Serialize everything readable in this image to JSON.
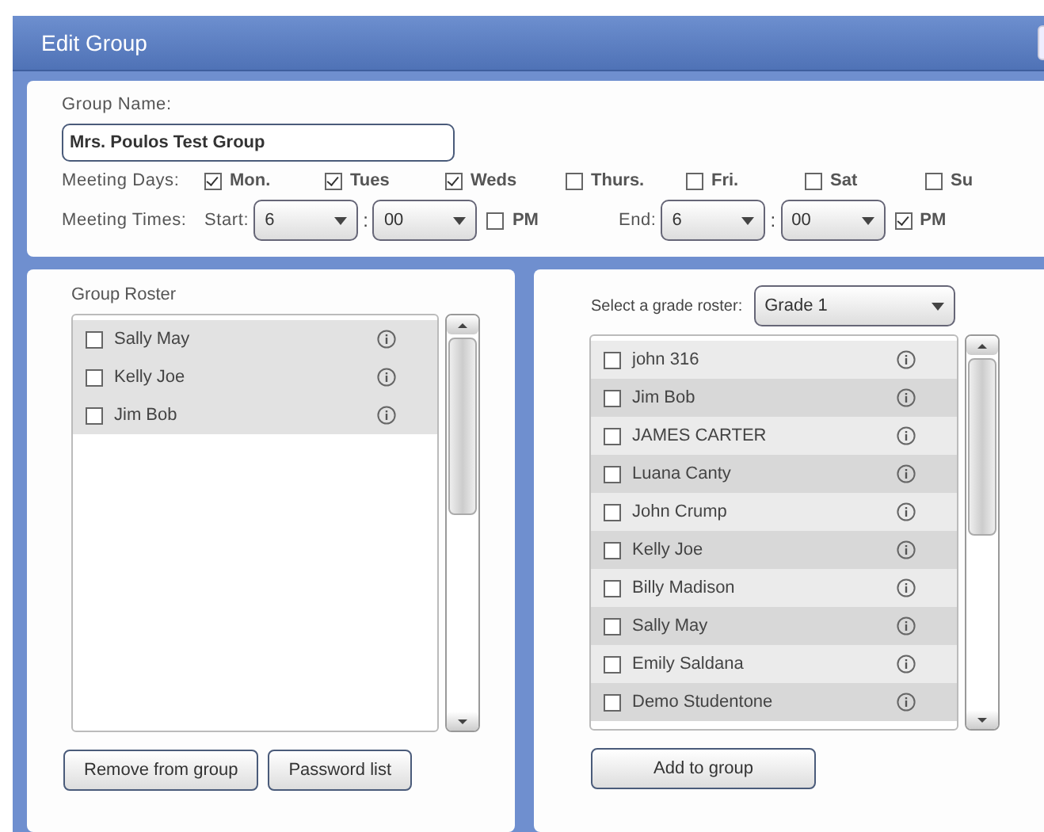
{
  "window": {
    "title": "Edit Group"
  },
  "group_name": {
    "label": "Group Name:",
    "value": "Mrs. Poulos Test Group"
  },
  "meeting_days": {
    "label": "Meeting Days:",
    "days": [
      {
        "label": "Mon.",
        "checked": true
      },
      {
        "label": "Tues",
        "checked": true
      },
      {
        "label": "Weds",
        "checked": true
      },
      {
        "label": "Thurs.",
        "checked": false
      },
      {
        "label": "Fri.",
        "checked": false
      },
      {
        "label": "Sat",
        "checked": false
      },
      {
        "label": "Su",
        "checked": false
      }
    ]
  },
  "meeting_times": {
    "label": "Meeting Times:",
    "start": {
      "label": "Start:",
      "hour": "6",
      "minute": "00",
      "separator": ":",
      "pm_label": "PM",
      "pm": false
    },
    "end": {
      "label": "End:",
      "hour": "6",
      "minute": "00",
      "separator": ":",
      "pm_label": "PM",
      "pm": true
    }
  },
  "group_roster": {
    "title": "Group Roster",
    "students": [
      {
        "name": "Sally May",
        "checked": false
      },
      {
        "name": "Kelly Joe",
        "checked": false
      },
      {
        "name": "Jim Bob",
        "checked": false
      }
    ],
    "buttons": [
      "Remove from group",
      "Password list"
    ]
  },
  "grade_roster": {
    "label": "Select a grade roster:",
    "grade": "Grade 1",
    "students": [
      {
        "name": "john 316",
        "checked": false
      },
      {
        "name": "Jim Bob",
        "checked": false
      },
      {
        "name": "JAMES CARTER",
        "checked": false
      },
      {
        "name": "Luana Canty",
        "checked": false
      },
      {
        "name": "John Crump",
        "checked": false
      },
      {
        "name": "Kelly Joe",
        "checked": false
      },
      {
        "name": "Billy Madison",
        "checked": false
      },
      {
        "name": "Sally May",
        "checked": false
      },
      {
        "name": "Emily Saldana",
        "checked": false
      },
      {
        "name": "Demo Studentone",
        "checked": false
      }
    ],
    "buttons": [
      "Add to group"
    ]
  }
}
